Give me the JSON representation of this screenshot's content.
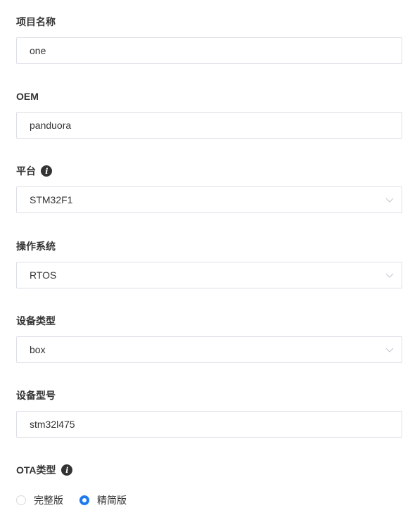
{
  "form": {
    "project_name": {
      "label": "项目名称",
      "value": "one"
    },
    "oem": {
      "label": "OEM",
      "value": "panduora"
    },
    "platform": {
      "label": "平台",
      "value": "STM32F1",
      "info_icon": "info-icon"
    },
    "os": {
      "label": "操作系统",
      "value": "RTOS"
    },
    "device_type": {
      "label": "设备类型",
      "value": "box"
    },
    "device_model": {
      "label": "设备型号",
      "value": "stm32l475"
    },
    "ota_type": {
      "label": "OTA类型",
      "info_icon": "info-icon",
      "options": [
        {
          "label": "完整版",
          "checked": false
        },
        {
          "label": "精简版",
          "checked": true
        }
      ]
    }
  },
  "colors": {
    "accent": "#1f7aeb",
    "border": "#dcdfe6",
    "text": "#333333",
    "chevron": "#c0c4cc"
  }
}
